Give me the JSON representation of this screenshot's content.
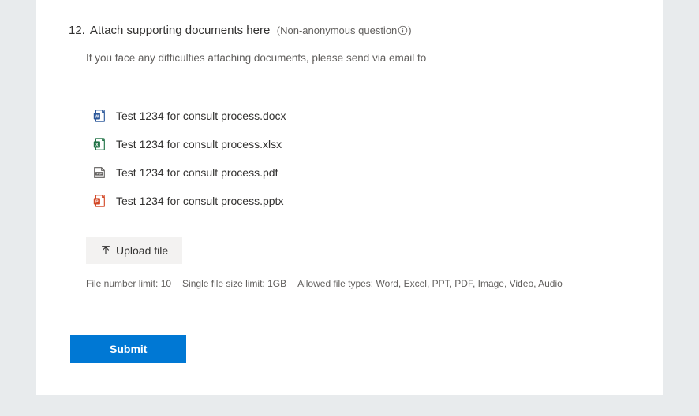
{
  "question": {
    "number": "12.",
    "title": "Attach supporting documents here",
    "meta_prefix": "(Non-anonymous question",
    "meta_suffix": ")",
    "description": "If you face any difficulties attaching documents, please send via email to"
  },
  "files": [
    {
      "name": "Test 1234 for consult process.docx",
      "type": "word"
    },
    {
      "name": "Test 1234 for consult process.xlsx",
      "type": "excel"
    },
    {
      "name": "Test 1234 for consult process.pdf",
      "type": "pdf"
    },
    {
      "name": "Test 1234 for consult process.pptx",
      "type": "powerpoint"
    }
  ],
  "upload": {
    "label": "Upload file"
  },
  "limits": {
    "file_number": "File number limit: 10",
    "file_size": "Single file size limit: 1GB",
    "file_types": "Allowed file types: Word, Excel, PPT, PDF, Image, Video, Audio"
  },
  "submit": {
    "label": "Submit"
  }
}
